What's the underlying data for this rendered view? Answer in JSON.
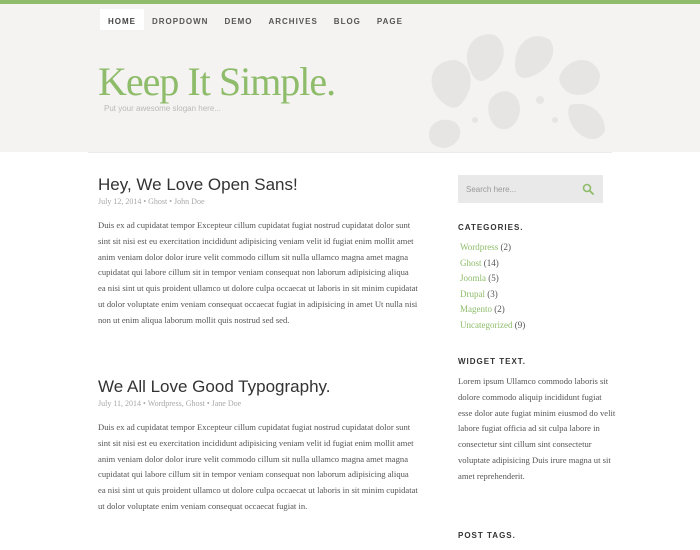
{
  "nav": {
    "items": [
      {
        "label": "HOME",
        "active": true
      },
      {
        "label": "DROPDOWN",
        "active": false
      },
      {
        "label": "DEMO",
        "active": false
      },
      {
        "label": "ARCHIVES",
        "active": false
      },
      {
        "label": "BLOG",
        "active": false
      },
      {
        "label": "PAGE",
        "active": false
      }
    ]
  },
  "header": {
    "title": "Keep It Simple.",
    "slogan": "Put your awesome slogan here..."
  },
  "posts": [
    {
      "title": "Hey, We Love Open Sans!",
      "meta": "July 12, 2014 • Ghost • John Doe",
      "body": "Duis ex ad cupidatat tempor Excepteur cillum cupidatat fugiat nostrud cupidatat dolor sunt sint sit nisi est eu exercitation incididunt adipisicing veniam velit id fugiat enim mollit amet anim veniam dolor dolor irure velit commodo cillum sit nulla ullamco magna amet magna cupidatat qui labore cillum sit in tempor veniam consequat non laborum adipisicing aliqua ea nisi sint ut quis proident ullamco ut dolore culpa occaecat ut laboris in sit minim cupidatat ut dolor voluptate enim veniam consequat occaecat fugiat in adipisicing in amet Ut nulla nisi non ut enim aliqua laborum mollit quis nostrud sed sed."
    },
    {
      "title": "We All Love Good Typography.",
      "meta": "July 11, 2014 • Wordpress, Ghost • Jane Doe",
      "body": "Duis ex ad cupidatat tempor Excepteur cillum cupidatat fugiat nostrud cupidatat dolor sunt sint sit nisi est eu exercitation incididunt adipisicing veniam velit id fugiat enim mollit amet anim veniam dolor dolor irure velit commodo cillum sit nulla ullamco magna amet magna cupidatat qui labore cillum sit in tempor veniam consequat non laborum adipisicing aliqua ea nisi sint ut quis proident ullamco ut dolore culpa occaecat ut laboris in sit minim cupidatat ut dolor voluptate enim veniam consequat occaecat fugiat in."
    }
  ],
  "sidebar": {
    "search_placeholder": "Search here...",
    "categories_title": "CATEGORIES.",
    "categories": [
      {
        "name": "Wordpress",
        "count": "(2)"
      },
      {
        "name": "Ghost",
        "count": "(14)"
      },
      {
        "name": "Joomla",
        "count": "(5)"
      },
      {
        "name": "Drupal",
        "count": "(3)"
      },
      {
        "name": "Magento",
        "count": "(2)"
      },
      {
        "name": "Uncategorized",
        "count": "(9)"
      }
    ],
    "widget_text_title": "WIDGET TEXT.",
    "widget_text": "Lorem ipsum Ullamco commodo laboris sit dolore commodo aliquip incididunt fugiat esse dolor aute fugiat minim eiusmod do velit labore fugiat officia ad sit culpa labore in consectetur sint cillum sint consectetur voluptate adipisicing Duis irure magna ut sit amet reprehenderit.",
    "post_tags_title": "POST TAGS."
  },
  "colors": {
    "accent": "#8ebc6a",
    "header_bg": "#f4f3f2",
    "search_bg": "#e9e9e9"
  }
}
